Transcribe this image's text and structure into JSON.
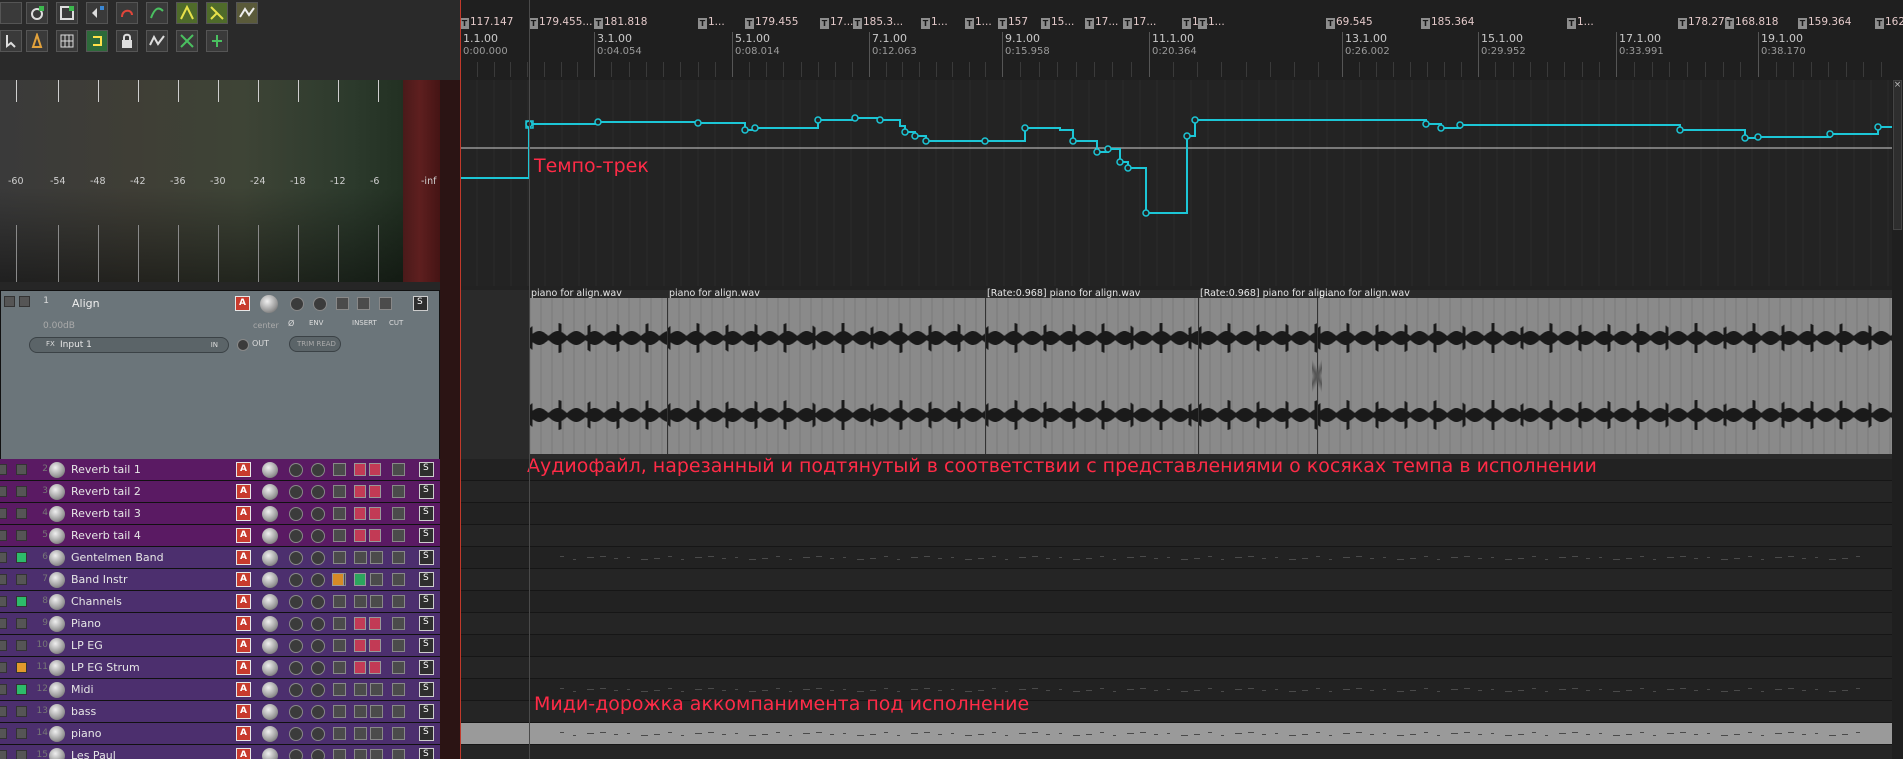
{
  "app": "REAPER",
  "meter": {
    "scale": [
      "-60",
      "-54",
      "-48",
      "-42",
      "-36",
      "-30",
      "-24",
      "-18",
      "-12",
      "-6",
      "-inf"
    ]
  },
  "tracks": {
    "main": {
      "num": "1",
      "name": "Align",
      "volume": "0.00dB",
      "pan": "center",
      "input": "Input 1",
      "in_label": "IN",
      "out_label": "OUT",
      "phase_label": "Ø",
      "env_label": "ENV",
      "insert_label": "INSERT",
      "cut_label": "CUT",
      "trim_label": "TRIM READ",
      "fx_label": "FX",
      "rec_label": "A",
      "send_label": "S"
    },
    "list": [
      {
        "num": "2",
        "name": "Reverb tail 1",
        "color": "purple"
      },
      {
        "num": "3",
        "name": "Reverb tail 2",
        "color": "purple"
      },
      {
        "num": "4",
        "name": "Reverb tail 3",
        "color": "purple"
      },
      {
        "num": "5",
        "name": "Reverb tail 4",
        "color": "purple"
      },
      {
        "num": "6",
        "name": "Gentelmen Band",
        "color": "violet"
      },
      {
        "num": "7",
        "name": "Band Instr",
        "color": "violet"
      },
      {
        "num": "8",
        "name": "Channels",
        "color": "violet"
      },
      {
        "num": "9",
        "name": "Piano",
        "color": "violet"
      },
      {
        "num": "10",
        "name": "LP EG",
        "color": "violet"
      },
      {
        "num": "11",
        "name": "LP EG Strum",
        "color": "violet"
      },
      {
        "num": "12",
        "name": "Midi",
        "color": "violet"
      },
      {
        "num": "13",
        "name": "bass",
        "color": "violet"
      },
      {
        "num": "14",
        "name": "piano",
        "color": "violet"
      },
      {
        "num": "15",
        "name": "Les Paul",
        "color": "violet"
      }
    ]
  },
  "ruler": {
    "tempo_markers": [
      "117.147",
      "179.455...",
      "181.818",
      "1...",
      "179.455",
      "17...",
      "185.3...",
      "1...",
      "1...",
      "157",
      "15...",
      "17...",
      "17...",
      "1...",
      "1...",
      "69.545",
      "185.364",
      "1...",
      "178.273",
      "168.818",
      "159.364",
      "162..."
    ],
    "bars": [
      {
        "label": "1.1.00",
        "time": "0:00.000"
      },
      {
        "label": "3.1.00",
        "time": "0:04.054"
      },
      {
        "label": "5.1.00",
        "time": "0:08.014"
      },
      {
        "label": "7.1.00",
        "time": "0:12.063"
      },
      {
        "label": "9.1.00",
        "time": "0:15.958"
      },
      {
        "label": "11.1.00",
        "time": "0:20.364"
      },
      {
        "label": "13.1.00",
        "time": "0:26.002"
      },
      {
        "label": "15.1.00",
        "time": "0:29.952"
      },
      {
        "label": "17.1.00",
        "time": "0:33.991"
      },
      {
        "label": "19.1.00",
        "time": "0:38.170"
      }
    ]
  },
  "items": [
    {
      "title": "piano for align.wav"
    },
    {
      "title": "piano for align.wav"
    },
    {
      "title": "[Rate:0.968] piano for align.wav"
    },
    {
      "title": "[Rate:0.968] piano for alig..."
    },
    {
      "title": "piano for align.wav"
    }
  ],
  "annotations": {
    "tempo": "Темпо-трек",
    "audio": "Аудиофайл, нарезанный и подтянутый в соответствии с представлениями о косяках темпа в исполнении",
    "midi": "Миди-дорожка аккомпанимента под исполнение"
  },
  "colors": {
    "tempo_line": "#1cc6d6",
    "annotation": "#ff2b47",
    "track_purple": "#5a1a63",
    "track_violet": "#4c2f6e",
    "playhead": "#c0392b"
  }
}
